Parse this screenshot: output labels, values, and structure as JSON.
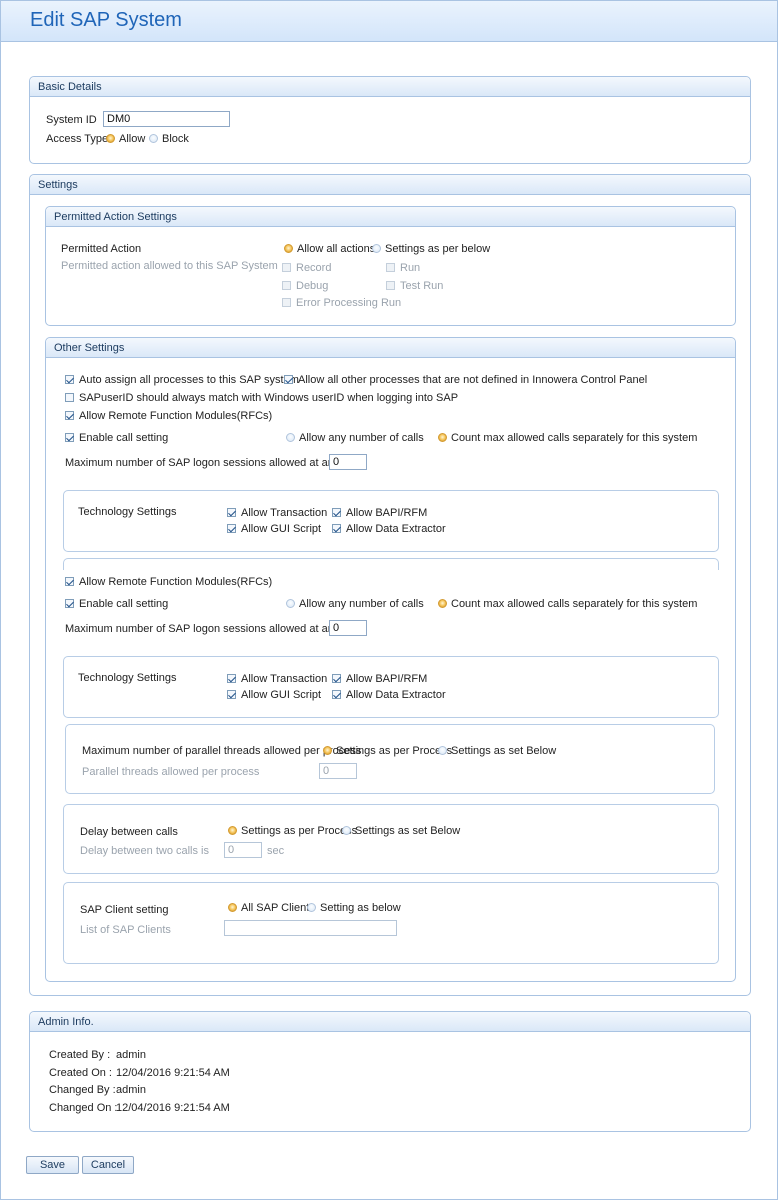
{
  "page": {
    "title": "Edit SAP System"
  },
  "basic": {
    "header": "Basic Details",
    "system_id_label": "System ID",
    "system_id_value": "DM0",
    "access_type_label": "Access Type",
    "allow_label": "Allow",
    "block_label": "Block",
    "access_selected": "Allow"
  },
  "settings": {
    "header": "Settings",
    "permitted": {
      "header": "Permitted Action Settings",
      "label": "Permitted Action",
      "hint": "Permitted action allowed to this SAP System",
      "allow_all": "Allow all actions",
      "settings_below": "Settings as per below",
      "record": "Record",
      "run": "Run",
      "debug": "Debug",
      "test_run": "Test Run",
      "error_run": "Error Processing Run"
    },
    "other": {
      "header": "Other Settings",
      "auto_assign": "Auto assign all processes to this SAP system",
      "allow_other": "Allow all other processes that are not defined in Innowera Control Panel",
      "sapuser_match": "SAPuserID should always match with Windows userID when logging into SAP",
      "allow_rfc": "Allow Remote Function Modules(RFCs)",
      "enable_call": "Enable call setting",
      "any_calls": "Allow any number of calls",
      "count_max": "Count max allowed calls separately for this system",
      "max_sessions_label": "Maximum number of SAP logon sessions allowed at any time",
      "max_sessions_value": "0",
      "tech_label": "Technology Settings",
      "allow_transaction": "Allow Transaction",
      "allow_bapi": "Allow BAPI/RFM",
      "allow_gui": "Allow GUI Script",
      "allow_extractor": "Allow Data Extractor",
      "allow_rfc_2": "Allow Remote Function Modules(RFCs)",
      "enable_call_2": "Enable call setting",
      "any_calls_2": "Allow any number of calls",
      "count_max_2": "Count max allowed calls separately for this system",
      "max_sessions_label_2": "Maximum number of SAP logon sessions allowed at any time",
      "max_sessions_value_2": "0",
      "tech_label_2": "Technology Settings",
      "allow_transaction_2": "Allow Transaction",
      "allow_bapi_2": "Allow BAPI/RFM",
      "allow_gui_2": "Allow GUI Script",
      "allow_extractor_2": "Allow Data Extractor",
      "threads_label": "Maximum number of parallel threads allowed per process",
      "threads_per_process": "Settings as per Process",
      "threads_set_below": "Settings as set Below",
      "threads_hint": "Parallel threads allowed per process",
      "threads_value": "0",
      "delay_label": "Delay between calls",
      "delay_per_process": "Settings as per Process",
      "delay_set_below": "Settings as set Below",
      "delay_hint": "Delay between two calls is",
      "delay_value": "0",
      "delay_unit": "sec",
      "client_label": "SAP Client setting",
      "client_all": "All SAP Client",
      "client_below": "Setting as below",
      "client_list_label": "List of SAP Clients",
      "client_list_value": ""
    }
  },
  "admin": {
    "header": "Admin Info.",
    "created_by_label": "Created By :",
    "created_by": "admin",
    "created_on_label": "Created On :",
    "created_on": "12/04/2016 9:21:54 AM",
    "changed_by_label": "Changed By :",
    "changed_by": "admin",
    "changed_on_label": "Changed On :",
    "changed_on": "12/04/2016 9:21:54 AM"
  },
  "buttons": {
    "save": "Save",
    "cancel": "Cancel"
  },
  "colors": {
    "title": "#1f65b8",
    "border": "#a9c3e2",
    "header_bg": "#dae8f8"
  }
}
